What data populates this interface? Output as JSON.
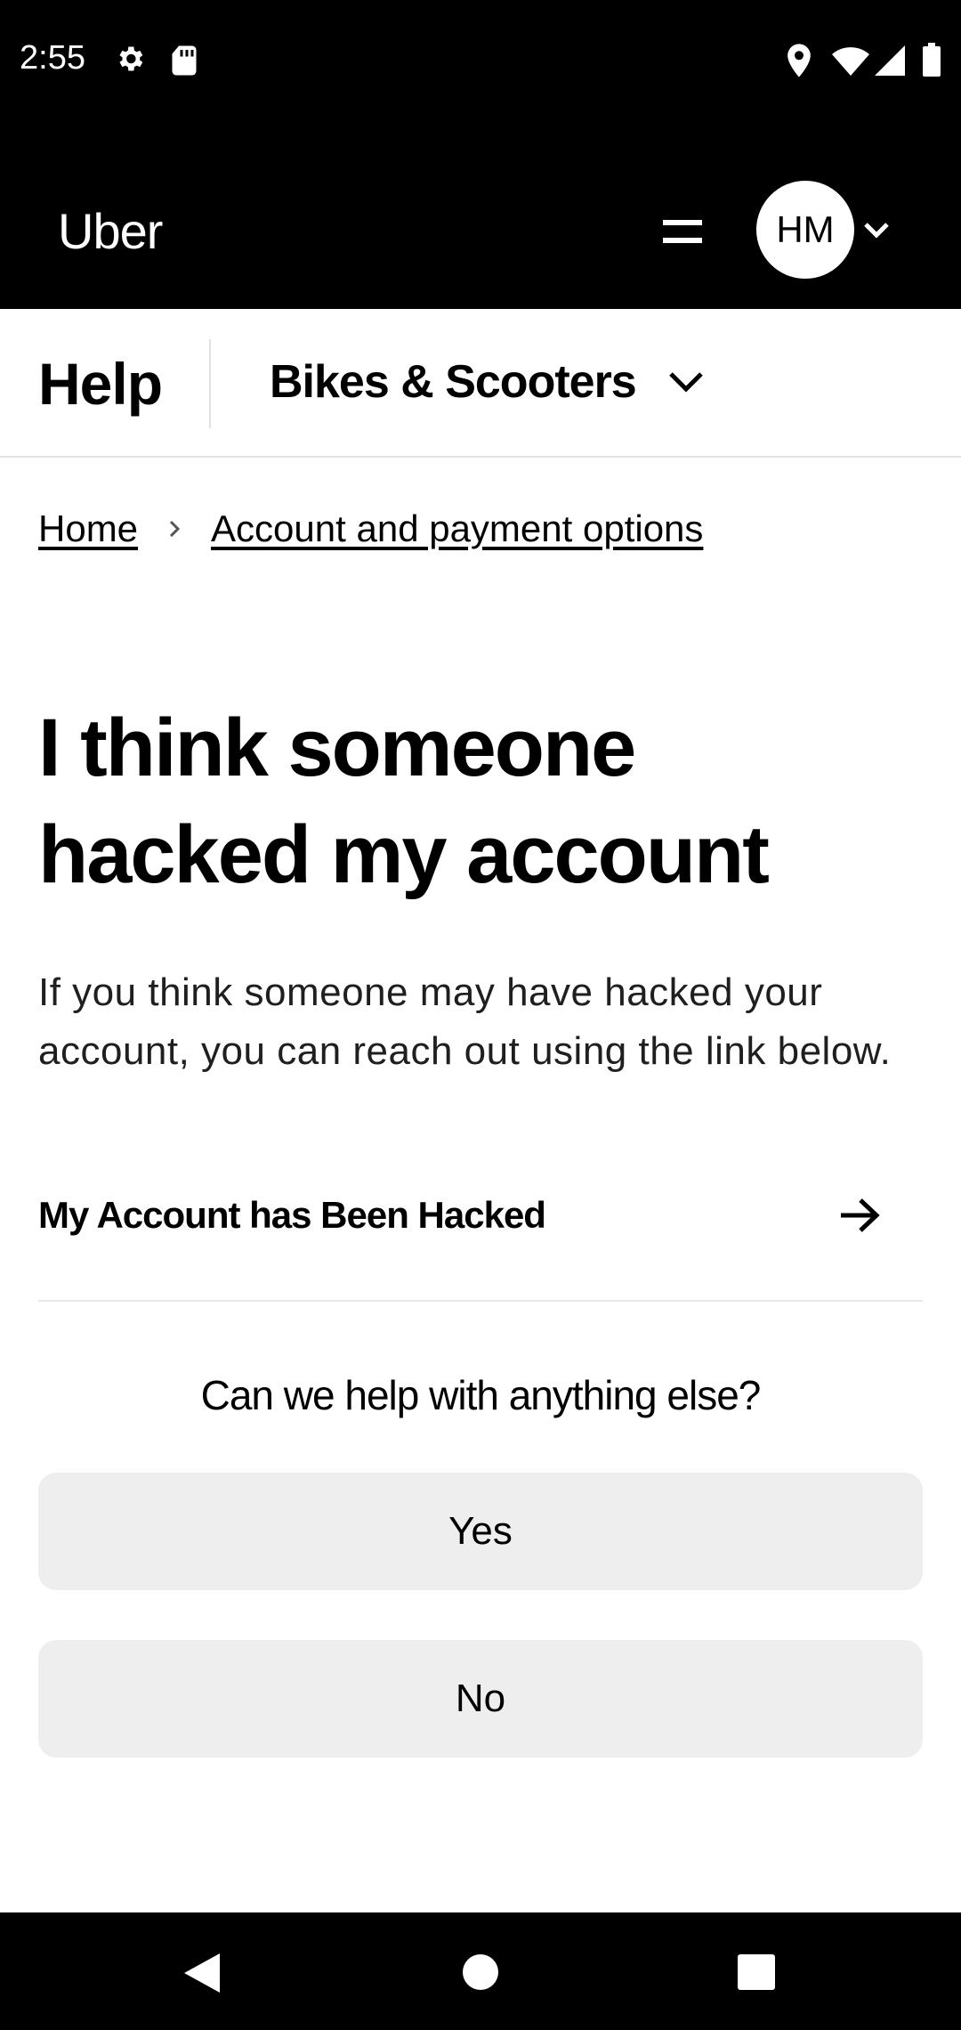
{
  "status_bar": {
    "time": "2:55",
    "icons": [
      "gear-icon",
      "sd-card-icon",
      "location-icon",
      "wifi-icon",
      "signal-icon",
      "battery-icon"
    ]
  },
  "header": {
    "logo": "Uber",
    "menu_icon": "hamburger-menu-icon",
    "avatar_initials": "HM",
    "avatar_chevron_icon": "chevron-down-icon"
  },
  "subnav": {
    "help_label": "Help",
    "category_label": "Bikes & Scooters",
    "category_chevron_icon": "chevron-down-icon"
  },
  "breadcrumb": {
    "items": [
      {
        "label": "Home"
      },
      {
        "label": "Account and payment options"
      }
    ],
    "separator_icon": "chevron-right-icon"
  },
  "article": {
    "title": "I think someone hacked my account",
    "intro": "If you think someone may have hacked your account, you can reach out using the link below.",
    "link_label": "My Account has Been Hacked",
    "link_icon": "arrow-right-icon"
  },
  "feedback": {
    "question": "Can we help with anything else?",
    "yes_label": "Yes",
    "no_label": "No"
  },
  "nav_bar": {
    "icons": [
      "back-icon",
      "home-icon",
      "recents-icon"
    ]
  },
  "colors": {
    "header_bg": "#000000",
    "button_bg": "#eeeeee",
    "divider": "#e2e2e2"
  }
}
